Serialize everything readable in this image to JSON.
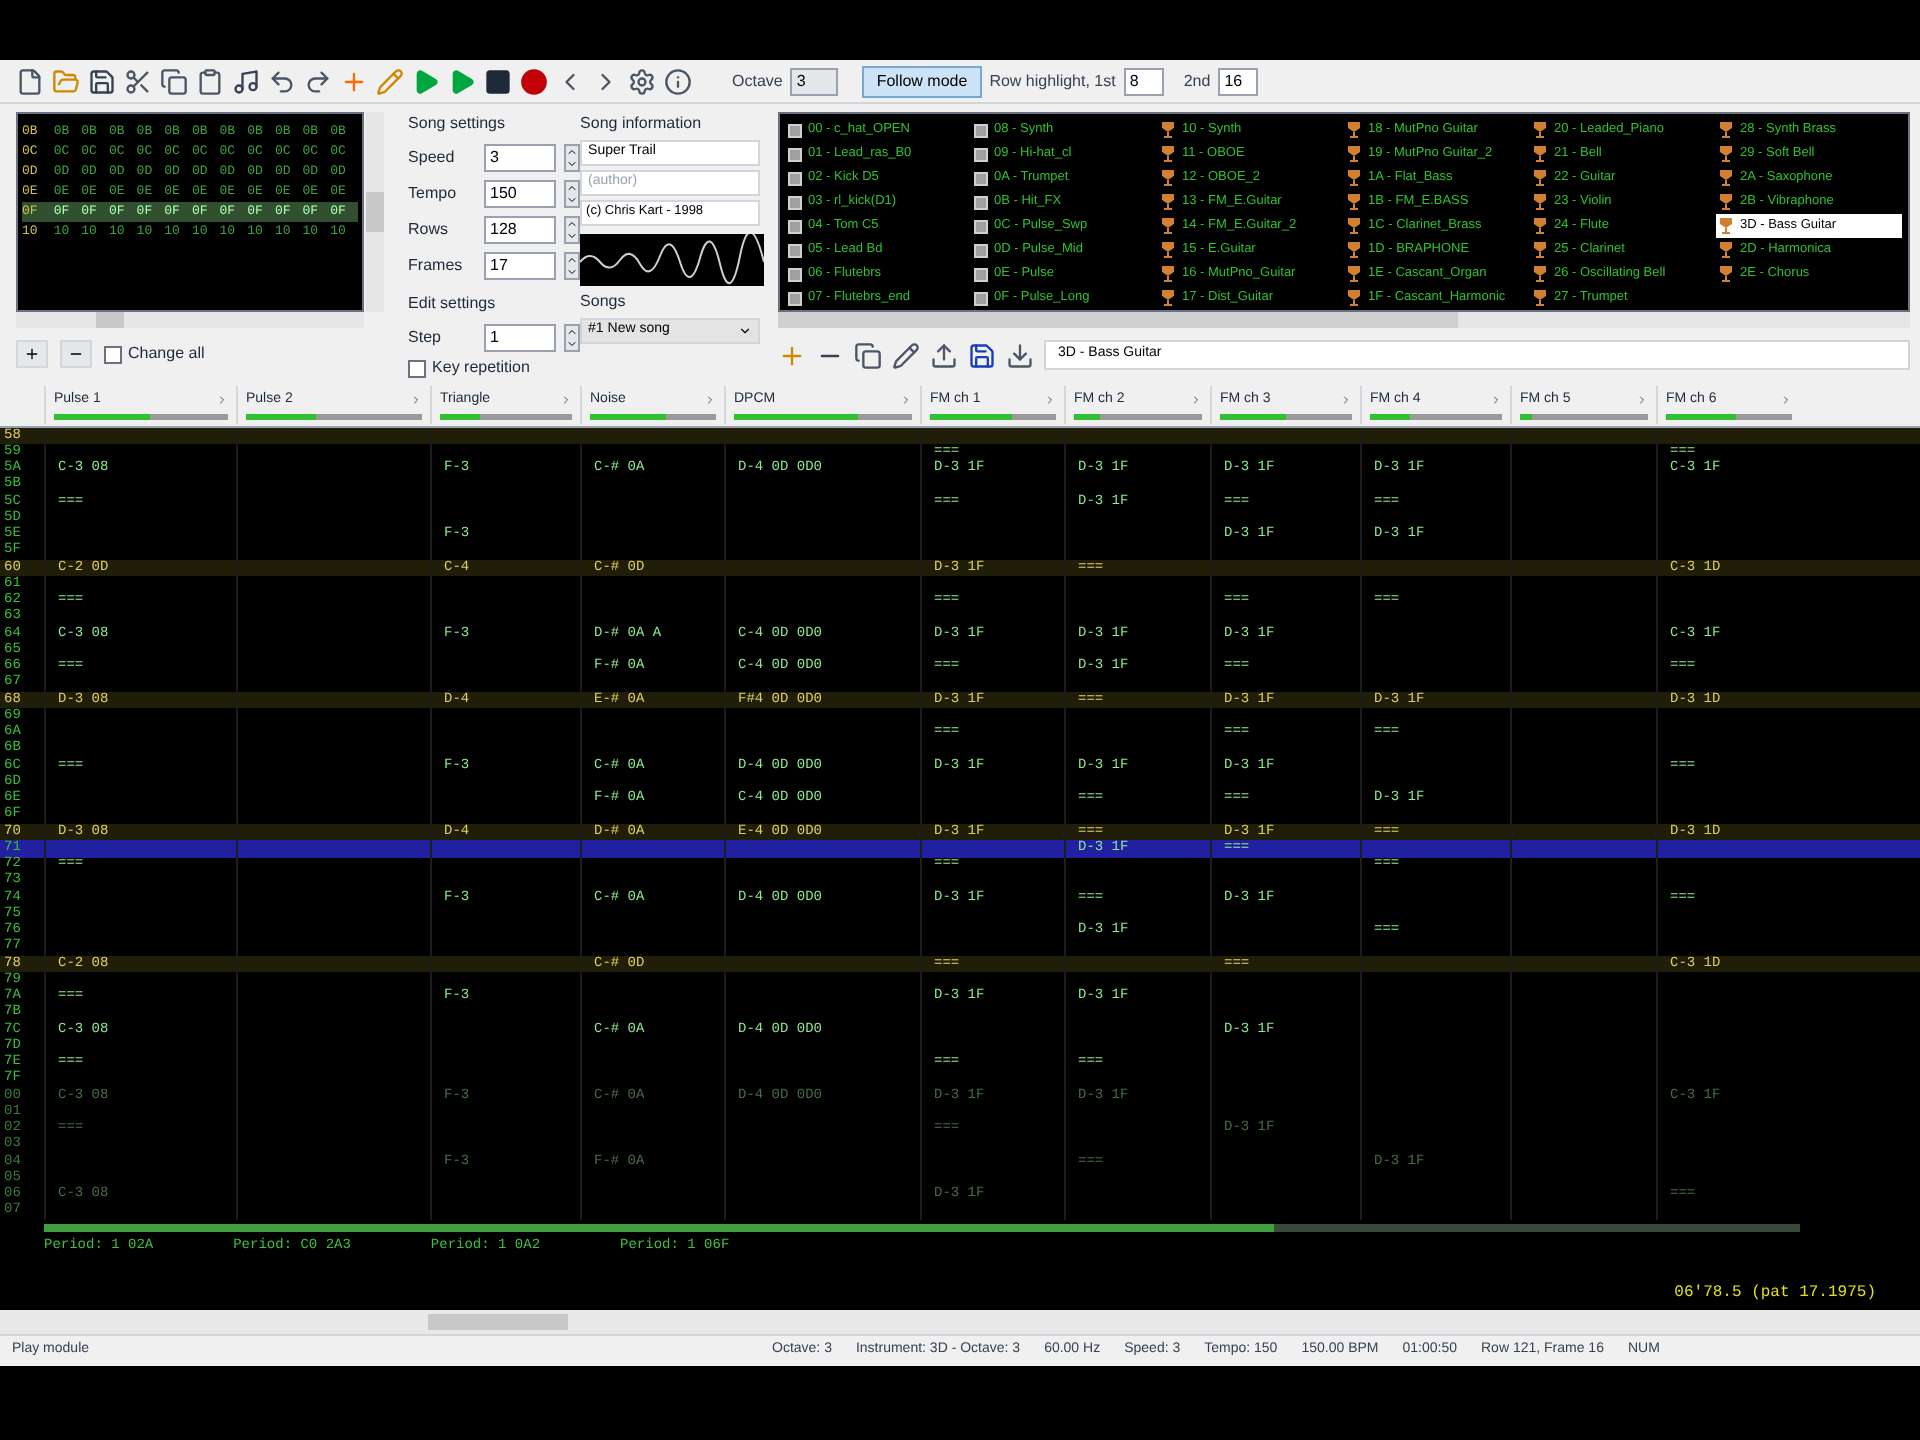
{
  "toolbar": {
    "octave_label": "Octave",
    "octave": "3",
    "follow_mode": {
      "label": "Follow mode",
      "on": true
    },
    "highlight_label": "Row highlight, 1st",
    "highlight_1st": "8",
    "second_label": "2nd",
    "highlight_2nd": "16"
  },
  "frames": {
    "rows": [
      {
        "number": "0B",
        "values": [
          "0B",
          "0B",
          "0B",
          "0B",
          "0B",
          "0B",
          "0B",
          "0B",
          "0B",
          "0B",
          "0B"
        ],
        "selected": false
      },
      {
        "number": "0C",
        "values": [
          "0C",
          "0C",
          "0C",
          "0C",
          "0C",
          "0C",
          "0C",
          "0C",
          "0C",
          "0C",
          "0C"
        ],
        "selected": false
      },
      {
        "number": "0D",
        "values": [
          "0D",
          "0D",
          "0D",
          "0D",
          "0D",
          "0D",
          "0D",
          "0D",
          "0D",
          "0D",
          "0D"
        ],
        "selected": false
      },
      {
        "number": "0E",
        "values": [
          "0E",
          "0E",
          "0E",
          "0E",
          "0E",
          "0E",
          "0E",
          "0E",
          "0E",
          "0E",
          "0E"
        ],
        "selected": false
      },
      {
        "number": "0F",
        "values": [
          "0F",
          "0F",
          "0F",
          "0F",
          "0F",
          "0F",
          "0F",
          "0F",
          "0F",
          "0F",
          "0F"
        ],
        "selected": true
      },
      {
        "number": "10",
        "values": [
          "10",
          "10",
          "10",
          "10",
          "10",
          "10",
          "10",
          "10",
          "10",
          "10",
          "10"
        ],
        "selected": false
      }
    ],
    "change_all": {
      "label": "Change all",
      "checked": false
    }
  },
  "song_settings": {
    "title": "Song settings",
    "fields": [
      {
        "label": "Speed",
        "value": "3"
      },
      {
        "label": "Tempo",
        "value": "150"
      },
      {
        "label": "Rows",
        "value": "128"
      },
      {
        "label": "Frames",
        "value": "17"
      }
    ]
  },
  "edit_settings": {
    "title": "Edit settings",
    "step_label": "Step",
    "step": "1",
    "key_repetition": {
      "label": "Key repetition",
      "checked": false
    }
  },
  "song_information": {
    "title": "Song information",
    "name": "Super Trail",
    "author": "(author)",
    "copyright": "(c) Chris Kart - 1998",
    "songs_label": "Songs",
    "song": "#1 New song"
  },
  "instruments": [
    {
      "name": "00 - c_hat_OPEN",
      "kind": "apu",
      "selected": false
    },
    {
      "name": "01 - Lead_ras_B0",
      "kind": "apu",
      "selected": false
    },
    {
      "name": "02 - Kick D5",
      "kind": "apu",
      "selected": false
    },
    {
      "name": "03 - rl_kick(D1)",
      "kind": "apu",
      "selected": false
    },
    {
      "name": "04 - Tom C5",
      "kind": "apu",
      "selected": false
    },
    {
      "name": "05 - Lead Bd",
      "kind": "apu",
      "selected": false
    },
    {
      "name": "06 - Flutebrs",
      "kind": "apu",
      "selected": false
    },
    {
      "name": "07 - Flutebrs_end",
      "kind": "apu",
      "selected": false
    },
    {
      "name": "08 - Synth",
      "kind": "apu",
      "selected": false
    },
    {
      "name": "09 - Hi-hat_cl",
      "kind": "apu",
      "selected": false
    },
    {
      "name": "0A - Trumpet",
      "kind": "apu",
      "selected": false
    },
    {
      "name": "0B - Hit_FX",
      "kind": "apu",
      "selected": false
    },
    {
      "name": "0C - Pulse_Swp",
      "kind": "apu",
      "selected": false
    },
    {
      "name": "0D - Pulse_Mid",
      "kind": "apu",
      "selected": false
    },
    {
      "name": "0E - Pulse",
      "kind": "apu",
      "selected": false
    },
    {
      "name": "0F - Pulse_Long",
      "kind": "apu",
      "selected": false
    },
    {
      "name": "10 - Synth",
      "kind": "vrc",
      "selected": false
    },
    {
      "name": "11 - OBOE",
      "kind": "vrc",
      "selected": false
    },
    {
      "name": "12 - OBOE_2",
      "kind": "vrc",
      "selected": false
    },
    {
      "name": "13 - FM_E.Guitar",
      "kind": "vrc",
      "selected": false
    },
    {
      "name": "14 - FM_E.Guitar_2",
      "kind": "vrc",
      "selected": false
    },
    {
      "name": "15 - E.Guitar",
      "kind": "vrc",
      "selected": false
    },
    {
      "name": "16 - MutPno_Guitar",
      "kind": "vrc",
      "selected": false
    },
    {
      "name": "17 - Dist_Guitar",
      "kind": "vrc",
      "selected": false
    },
    {
      "name": "18 - MutPno Guitar",
      "kind": "vrc",
      "selected": false
    },
    {
      "name": "19 - MutPno Guitar_2",
      "kind": "vrc",
      "selected": false
    },
    {
      "name": "1A - Flat_Bass",
      "kind": "vrc",
      "selected": false
    },
    {
      "name": "1B - FM_E.BASS",
      "kind": "vrc",
      "selected": false
    },
    {
      "name": "1C - Clarinet_Brass",
      "kind": "vrc",
      "selected": false
    },
    {
      "name": "1D - BRAPHONE",
      "kind": "vrc",
      "selected": false
    },
    {
      "name": "1E - Cascant_Organ",
      "kind": "vrc",
      "selected": false
    },
    {
      "name": "1F - Cascant_Harmonic",
      "kind": "vrc",
      "selected": false
    },
    {
      "name": "20 - Leaded_Piano",
      "kind": "vrc",
      "selected": false
    },
    {
      "name": "21 - Bell",
      "kind": "vrc",
      "selected": false
    },
    {
      "name": "22 - Guitar",
      "kind": "vrc",
      "selected": false
    },
    {
      "name": "23 - Violin",
      "kind": "vrc",
      "selected": false
    },
    {
      "name": "24 - Flute",
      "kind": "vrc",
      "selected": false
    },
    {
      "name": "25 - Clarinet",
      "kind": "vrc",
      "selected": false
    },
    {
      "name": "26 - Oscillating Bell",
      "kind": "vrc",
      "selected": false
    },
    {
      "name": "27 - Trumpet",
      "kind": "vrc",
      "selected": false
    },
    {
      "name": "28 - Synth Brass",
      "kind": "vrc",
      "selected": false
    },
    {
      "name": "29 - Soft Bell",
      "kind": "vrc",
      "selected": false
    },
    {
      "name": "2A - Saxophone",
      "kind": "vrc",
      "selected": false
    },
    {
      "name": "2B - Vibraphone",
      "kind": "vrc",
      "selected": false
    },
    {
      "name": "3D - Bass Guitar",
      "kind": "vrc",
      "selected": true
    },
    {
      "name": "2D - Harmonica",
      "kind": "vrc",
      "selected": false
    },
    {
      "name": "2E - Chorus",
      "kind": "vrc",
      "selected": false
    }
  ],
  "instrument_field": "3D - Bass Guitar",
  "channels": [
    {
      "name": "Pulse 1",
      "level": 0.55
    },
    {
      "name": "Pulse 2",
      "level": 0.4
    },
    {
      "name": "Triangle",
      "level": 0.3
    },
    {
      "name": "Noise",
      "level": 0.6
    },
    {
      "name": "DPCM",
      "level": 0.7
    },
    {
      "name": "FM ch 1",
      "level": 0.65
    },
    {
      "name": "FM ch 2",
      "level": 0.2
    },
    {
      "name": "FM ch 3",
      "level": 0.5
    },
    {
      "name": "FM ch 4",
      "level": 0.3
    },
    {
      "name": "FM ch 5",
      "level": 0.1
    },
    {
      "name": "FM ch 6",
      "level": 0.55
    }
  ],
  "rows": [
    {
      "number": "58",
      "cells": [
        {},
        {},
        {},
        {},
        {},
        {},
        {},
        {},
        {},
        {},
        {}
      ],
      "selected": false
    },
    {
      "number": "59",
      "cells": [
        {},
        {},
        {},
        {},
        {},
        {
          "text": "==="
        },
        {},
        {},
        {},
        {},
        {
          "text": "==="
        }
      ],
      "selected": false
    },
    {
      "number": "5A",
      "cells": [
        {
          "text": "C-3 08"
        },
        {},
        {
          "text": "F-3"
        },
        {
          "text": "C-# 0A"
        },
        {
          "text": "D-4 0D 0D0"
        },
        {
          "text": "D-3 1F"
        },
        {
          "text": "D-3 1F"
        },
        {
          "text": "D-3 1F"
        },
        {
          "text": "D-3 1F"
        },
        {},
        {
          "text": "C-3 1F"
        }
      ],
      "selected": false
    },
    {
      "number": "5B",
      "cells": [
        {},
        {},
        {},
        {},
        {},
        {},
        {},
        {},
        {},
        {},
        {}
      ],
      "selected": false
    },
    {
      "number": "5C",
      "cells": [
        {
          "text": "==="
        },
        {},
        {},
        {},
        {},
        {
          "text": "==="
        },
        {
          "text": "D-3 1F"
        },
        {
          "text": "==="
        },
        {
          "text": "==="
        },
        {},
        {}
      ],
      "selected": false
    },
    {
      "number": "5D",
      "cells": [
        {},
        {},
        {},
        {},
        {},
        {},
        {},
        {},
        {},
        {},
        {}
      ],
      "selected": false
    },
    {
      "number": "5E",
      "cells": [
        {},
        {},
        {
          "text": "F-3"
        },
        {},
        {},
        {},
        {},
        {
          "text": "D-3 1F"
        },
        {
          "text": "D-3 1F"
        },
        {},
        {}
      ],
      "selected": false
    },
    {
      "number": "5F",
      "cells": [
        {},
        {},
        {},
        {},
        {},
        {},
        {},
        {},
        {},
        {},
        {}
      ],
      "selected": false
    },
    {
      "number": "60",
      "cells": [
        {
          "text": "C-2 0D"
        },
        {},
        {
          "text": "C-4"
        },
        {
          "text": "C-# 0D"
        },
        {},
        {
          "text": "D-3 1F"
        },
        {
          "text": "==="
        },
        {},
        {},
        {},
        {
          "text": "C-3 1D"
        }
      ],
      "selected": false
    },
    {
      "number": "61",
      "cells": [
        {},
        {},
        {},
        {},
        {},
        {},
        {},
        {},
        {},
        {},
        {}
      ],
      "selected": false
    },
    {
      "number": "62",
      "cells": [
        {
          "text": "==="
        },
        {},
        {},
        {},
        {},
        {
          "text": "==="
        },
        {},
        {
          "text": "==="
        },
        {
          "text": "==="
        },
        {},
        {}
      ],
      "selected": false
    },
    {
      "number": "63",
      "cells": [
        {},
        {},
        {},
        {},
        {},
        {},
        {},
        {},
        {},
        {},
        {}
      ],
      "selected": false
    },
    {
      "number": "64",
      "cells": [
        {
          "text": "C-3 08"
        },
        {},
        {
          "text": "F-3"
        },
        {
          "text": "D-# 0A A"
        },
        {
          "text": "C-4 0D 0D0"
        },
        {
          "text": "D-3 1F"
        },
        {
          "text": "D-3 1F"
        },
        {
          "text": "D-3 1F"
        },
        {},
        {},
        {
          "text": "C-3 1F"
        }
      ],
      "selected": false
    },
    {
      "number": "65",
      "cells": [
        {},
        {},
        {},
        {},
        {},
        {},
        {},
        {},
        {},
        {},
        {}
      ],
      "selected": false
    },
    {
      "number": "66",
      "cells": [
        {
          "text": "==="
        },
        {},
        {},
        {
          "text": "F-# 0A"
        },
        {
          "text": "C-4 0D 0D0"
        },
        {
          "text": "==="
        },
        {
          "text": "D-3 1F"
        },
        {
          "text": "==="
        },
        {},
        {},
        {
          "text": "==="
        }
      ],
      "selected": false
    },
    {
      "number": "67",
      "cells": [
        {},
        {},
        {},
        {},
        {},
        {},
        {},
        {},
        {},
        {},
        {}
      ],
      "selected": false
    },
    {
      "number": "68",
      "cells": [
        {
          "text": "D-3 08"
        },
        {},
        {
          "text": "D-4"
        },
        {
          "text": "E-# 0A"
        },
        {
          "text": "F#4 0D 0D0"
        },
        {
          "text": "D-3 1F"
        },
        {
          "text": "==="
        },
        {
          "text": "D-3 1F"
        },
        {
          "text": "D-3 1F"
        },
        {},
        {
          "text": "D-3 1D"
        }
      ],
      "selected": false
    },
    {
      "number": "69",
      "cells": [
        {},
        {},
        {},
        {},
        {},
        {},
        {},
        {},
        {},
        {},
        {}
      ],
      "selected": false
    },
    {
      "number": "6A",
      "cells": [
        {},
        {},
        {},
        {},
        {},
        {
          "text": "==="
        },
        {},
        {
          "text": "==="
        },
        {
          "text": "==="
        },
        {},
        {}
      ],
      "selected": false
    },
    {
      "number": "6B",
      "cells": [
        {},
        {},
        {},
        {},
        {},
        {},
        {},
        {},
        {},
        {},
        {}
      ],
      "selected": false
    },
    {
      "number": "6C",
      "cells": [
        {
          "text": "==="
        },
        {},
        {
          "text": "F-3"
        },
        {
          "text": "C-# 0A"
        },
        {
          "text": "D-4 0D 0D0"
        },
        {
          "text": "D-3 1F"
        },
        {
          "text": "D-3 1F"
        },
        {
          "text": "D-3 1F"
        },
        {},
        {},
        {
          "text": "==="
        }
      ],
      "selected": false
    },
    {
      "number": "6D",
      "cells": [
        {},
        {},
        {},
        {},
        {},
        {},
        {},
        {},
        {},
        {},
        {}
      ],
      "selected": false
    },
    {
      "number": "6E",
      "cells": [
        {},
        {},
        {},
        {
          "text": "F-# 0A"
        },
        {
          "text": "C-4 0D 0D0"
        },
        {},
        {
          "text": "==="
        },
        {
          "text": "==="
        },
        {
          "text": "D-3 1F"
        },
        {},
        {}
      ],
      "selected": false
    },
    {
      "number": "6F",
      "cells": [
        {},
        {},
        {},
        {},
        {},
        {},
        {},
        {},
        {},
        {},
        {}
      ],
      "selected": false
    },
    {
      "number": "70",
      "cells": [
        {
          "text": "D-3 08"
        },
        {},
        {
          "text": "D-4"
        },
        {
          "text": "D-# 0A"
        },
        {
          "text": "E-4 0D 0D0"
        },
        {
          "text": "D-3 1F"
        },
        {
          "text": "==="
        },
        {
          "text": "D-3 1F"
        },
        {
          "text": "==="
        },
        {},
        {
          "text": "D-3 1D"
        }
      ],
      "selected": false
    },
    {
      "number": "71",
      "cells": [
        {},
        {},
        {},
        {},
        {},
        {},
        {
          "text": "D-3 1F"
        },
        {
          "text": "==="
        },
        {},
        {},
        {}
      ],
      "selected": true
    },
    {
      "number": "72",
      "cells": [
        {
          "text": "==="
        },
        {},
        {},
        {},
        {},
        {
          "text": "==="
        },
        {},
        {},
        {
          "text": "==="
        },
        {},
        {}
      ],
      "selected": false
    },
    {
      "number": "73",
      "cells": [
        {},
        {},
        {},
        {},
        {},
        {},
        {},
        {},
        {},
        {},
        {}
      ],
      "selected": false
    },
    {
      "number": "74",
      "cells": [
        {},
        {},
        {
          "text": "F-3"
        },
        {
          "text": "C-# 0A"
        },
        {
          "text": "D-4 0D 0D0"
        },
        {
          "text": "D-3 1F"
        },
        {
          "text": "==="
        },
        {
          "text": "D-3 1F"
        },
        {},
        {},
        {
          "text": "==="
        }
      ],
      "selected": false
    },
    {
      "number": "75",
      "cells": [
        {},
        {},
        {},
        {},
        {},
        {},
        {},
        {},
        {},
        {},
        {}
      ],
      "selected": false
    },
    {
      "number": "76",
      "cells": [
        {},
        {},
        {},
        {},
        {},
        {},
        {
          "text": "D-3 1F"
        },
        {},
        {
          "text": "==="
        },
        {},
        {}
      ],
      "selected": false
    },
    {
      "number": "77",
      "cells": [
        {},
        {},
        {},
        {},
        {},
        {},
        {},
        {},
        {},
        {},
        {}
      ],
      "selected": false
    },
    {
      "number": "78",
      "cells": [
        {
          "text": "C-2 08"
        },
        {},
        {},
        {
          "text": "C-# 0D"
        },
        {},
        {
          "text": "==="
        },
        {},
        {
          "text": "==="
        },
        {},
        {},
        {
          "text": "C-3 1D"
        }
      ],
      "selected": false
    },
    {
      "number": "79",
      "cells": [
        {},
        {},
        {},
        {},
        {},
        {},
        {},
        {},
        {},
        {},
        {}
      ],
      "selected": false
    },
    {
      "number": "7A",
      "cells": [
        {
          "text": "==="
        },
        {},
        {
          "text": "F-3"
        },
        {},
        {},
        {
          "text": "D-3 1F"
        },
        {
          "text": "D-3 1F"
        },
        {},
        {},
        {},
        {}
      ],
      "selected": false
    },
    {
      "number": "7B",
      "cells": [
        {},
        {},
        {},
        {},
        {},
        {},
        {},
        {},
        {},
        {},
        {}
      ],
      "selected": false
    },
    {
      "number": "7C",
      "cells": [
        {
          "text": "C-3 08"
        },
        {},
        {},
        {
          "text": "C-# 0A"
        },
        {
          "text": "D-4 0D 0D0"
        },
        {},
        {},
        {
          "text": "D-3 1F"
        },
        {},
        {},
        {}
      ],
      "selected": false
    },
    {
      "number": "7D",
      "cells": [
        {},
        {},
        {},
        {},
        {},
        {},
        {},
        {},
        {},
        {},
        {}
      ],
      "selected": false
    },
    {
      "number": "7E",
      "cells": [
        {
          "text": "==="
        },
        {},
        {},
        {},
        {},
        {
          "text": "==="
        },
        {
          "text": "==="
        },
        {},
        {},
        {},
        {}
      ],
      "selected": false
    },
    {
      "number": "7F",
      "cells": [
        {},
        {},
        {},
        {},
        {},
        {},
        {},
        {},
        {},
        {},
        {}
      ],
      "selected": false
    }
  ],
  "next_frame_rows": [
    {
      "number": "00",
      "cells": [
        {
          "text": "C-3 08"
        },
        {},
        {
          "text": "F-3"
        },
        {
          "text": "C-# 0A"
        },
        {
          "text": "D-4 0D 0D0"
        },
        {
          "text": "D-3 1F"
        },
        {
          "text": "D-3 1F"
        },
        {},
        {},
        {},
        {
          "text": "C-3 1F"
        }
      ]
    },
    {
      "number": "01",
      "cells": [
        {},
        {},
        {},
        {},
        {},
        {},
        {},
        {},
        {},
        {},
        {}
      ]
    },
    {
      "number": "02",
      "cells": [
        {
          "text": "==="
        },
        {},
        {},
        {},
        {},
        {
          "text": "==="
        },
        {},
        {
          "text": "D-3 1F"
        },
        {},
        {},
        {}
      ]
    },
    {
      "number": "03",
      "cells": [
        {},
        {},
        {},
        {},
        {},
        {},
        {},
        {},
        {},
        {},
        {}
      ]
    },
    {
      "number": "04",
      "cells": [
        {},
        {},
        {
          "text": "F-3"
        },
        {
          "text": "F-# 0A"
        },
        {},
        {},
        {
          "text": "==="
        },
        {},
        {
          "text": "D-3 1F"
        },
        {},
        {}
      ]
    },
    {
      "number": "05",
      "cells": [
        {},
        {},
        {},
        {},
        {},
        {},
        {},
        {},
        {},
        {},
        {}
      ]
    },
    {
      "number": "06",
      "cells": [
        {
          "text": "C-3 08"
        },
        {},
        {},
        {},
        {},
        {
          "text": "D-3 1F"
        },
        {},
        {},
        {},
        {},
        {
          "text": "==="
        }
      ]
    },
    {
      "number": "07",
      "cells": [
        {},
        {},
        {},
        {},
        {},
        {},
        {},
        {},
        {},
        {},
        {}
      ]
    }
  ],
  "registers": [
    {
      "text": "Period: 1 02A"
    },
    {
      "text": "Period: C0 2A3"
    },
    {
      "text": "Period: 1 0A2"
    },
    {
      "text": "Period: 1 06F"
    }
  ],
  "position": "06'78.5 (pat 17.1975)",
  "status_bar": [
    "Play module",
    "Octave: 3",
    "Instrument: 3D - Octave: 3",
    "60.00 Hz",
    "Speed: 3",
    "Tempo: 150",
    "150.00 BPM",
    "01:00:50",
    "Row 121, Frame 16",
    "NUM"
  ]
}
